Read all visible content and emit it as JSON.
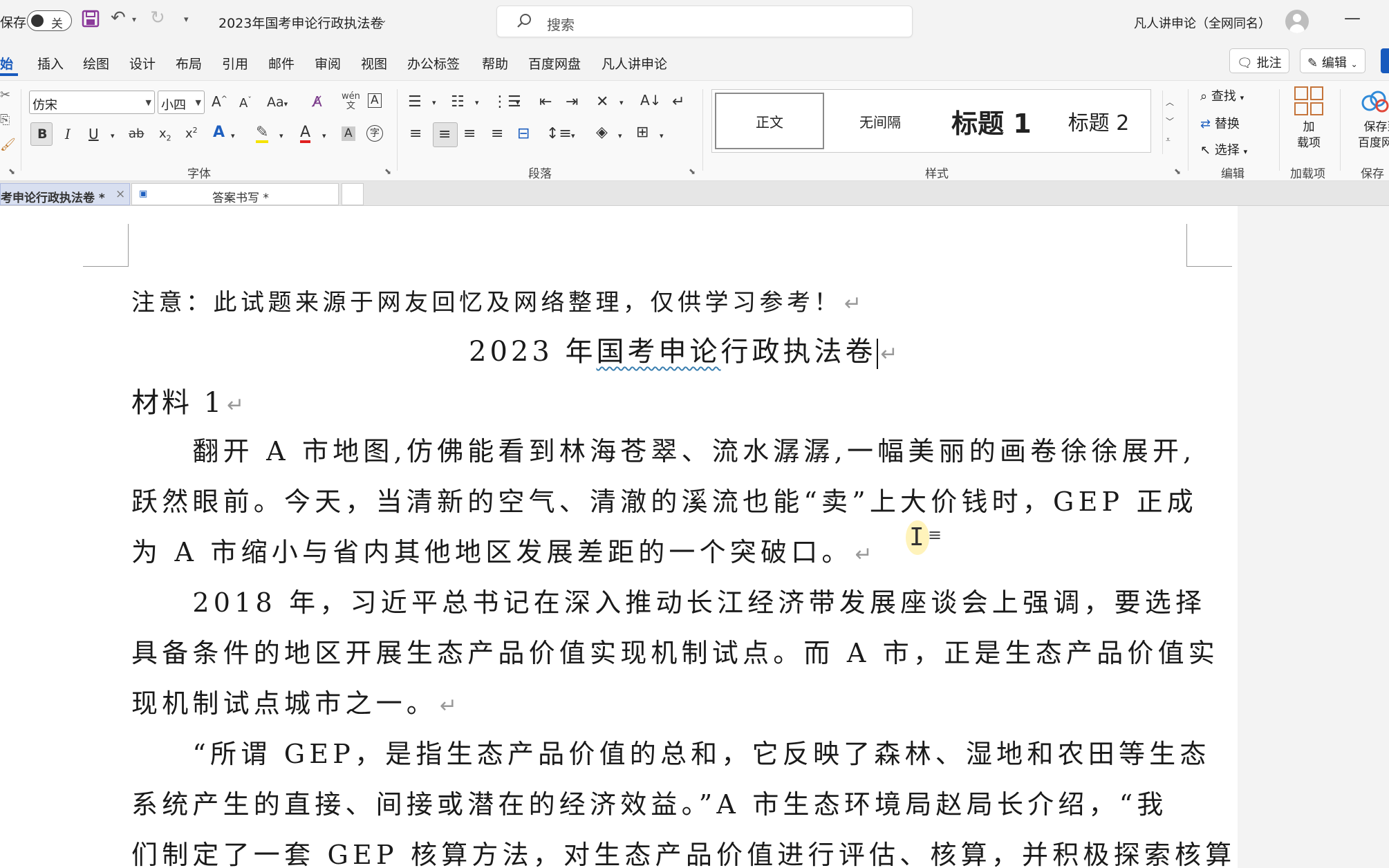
{
  "titlebar": {
    "autosave_label": "保存",
    "toggle_state": "关",
    "doc_title": "2023年国考申论行政执法卷",
    "search_placeholder": "搜索",
    "user_name": "凡人讲申论（全网同名）"
  },
  "menu": {
    "items": [
      "开始",
      "插入",
      "绘图",
      "设计",
      "布局",
      "引用",
      "邮件",
      "审阅",
      "视图",
      "办公标签",
      "帮助",
      "百度网盘",
      "凡人讲申论"
    ],
    "active_display": "开始",
    "comment_btn": "批注",
    "edit_btn": "编辑"
  },
  "ribbon": {
    "font": {
      "name": "仿宋",
      "size": "小四",
      "label": "字体"
    },
    "paragraph": {
      "label": "段落"
    },
    "styles": {
      "label": "样式",
      "items": [
        "正文",
        "无间隔",
        "标题 1",
        "标题 2"
      ]
    },
    "editing": {
      "label": "编辑",
      "find": "查找",
      "replace": "替换",
      "select": "选择"
    },
    "addins": {
      "label": "加载项",
      "button": "加载项",
      "button_l1": "加",
      "button_l2": "载项"
    },
    "save": {
      "label": "保存",
      "l1": "保存到",
      "l2": "百度网盘"
    }
  },
  "tabs": [
    {
      "label": "考申论行政执法卷 *",
      "active": true
    },
    {
      "label": "答案书写 *",
      "active": false
    }
  ],
  "document": {
    "note": "注意：此试题来源于网友回忆及网络整理，仅供学习参考！",
    "title_prefix": "2023 年",
    "title_wavy": "国考申论",
    "title_suffix": "行政执法卷",
    "heading": "材料 1",
    "lines": [
      "　　翻开 A 市地图,仿佛能看到林海苍翠、流水潺潺,一幅美丽的画卷徐徐展开,",
      "跃然眼前。今天，当清新的空气、清澈的溪流也能“卖”上大价钱时，GEP 正成",
      "为 A 市缩小与省内其他地区发展差距的一个突破口。",
      "　　2018 年，习近平总书记在深入推动长江经济带发展座谈会上强调，要选择",
      "具备条件的地区开展生态产品价值实现机制试点。而 A 市，正是生态产品价值实",
      "现机制试点城市之一。",
      "　　“所谓 GEP，是指生态产品价值的总和，它反映了森林、湿地和农田等生态",
      "系统产生的直接、间接或潜在的经济效益。”A 市生态环境局赵局长介绍，“我",
      "们制定了一套 GEP 核算方法，对生态产品价值进行评估、核算，并积极探索核算"
    ]
  }
}
